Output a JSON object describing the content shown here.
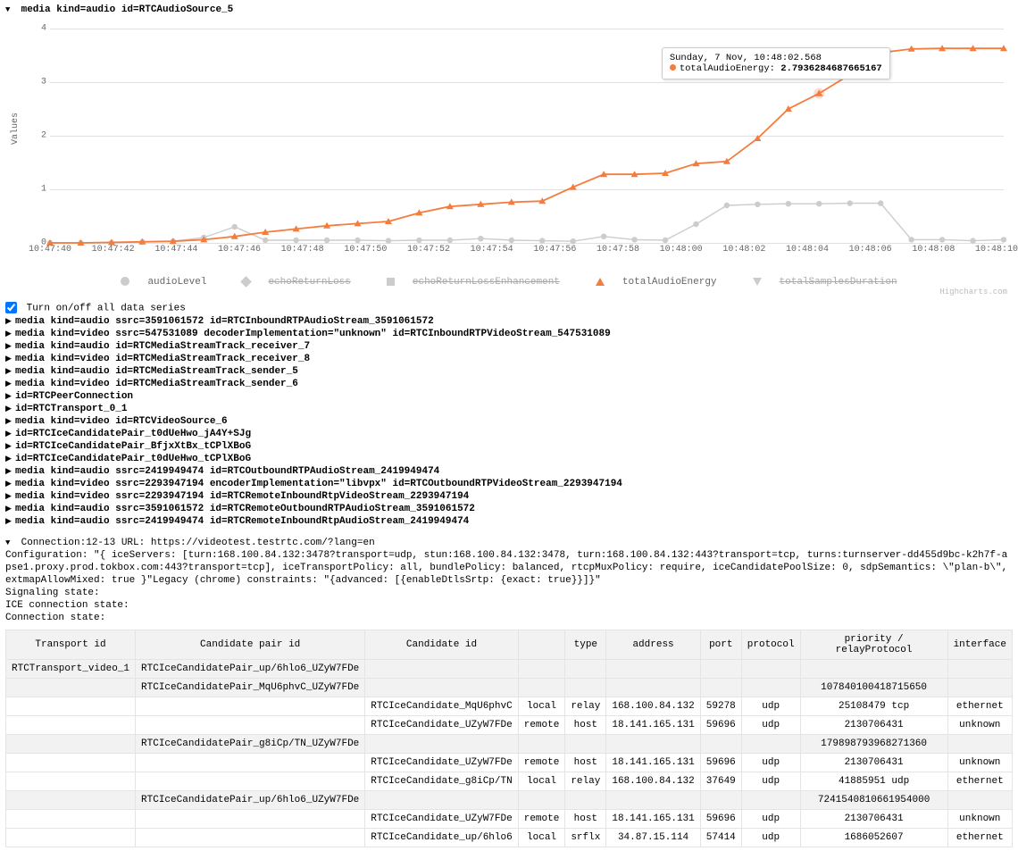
{
  "header": {
    "expanded_item": "media kind=audio id=RTCAudioSource_5"
  },
  "chart_data": {
    "type": "line",
    "ylabel": "Values",
    "xlabel": "",
    "ylim": [
      0,
      4
    ],
    "y_ticks": [
      0,
      1,
      2,
      3,
      4
    ],
    "x_ticks": [
      "10:47:40",
      "10:47:42",
      "10:47:44",
      "10:47:46",
      "10:47:48",
      "10:47:50",
      "10:47:52",
      "10:47:54",
      "10:47:56",
      "10:47:58",
      "10:48:00",
      "10:48:02",
      "10:48:04",
      "10:48:06",
      "10:48:08",
      "10:48:10"
    ],
    "series": [
      {
        "name": "audioLevel",
        "color": "#cccccc",
        "active": true,
        "marker": "circle",
        "values": [
          0,
          0,
          0,
          0.02,
          0.03,
          0.1,
          0.3,
          0.05,
          0.05,
          0.05,
          0.05,
          0.04,
          0.05,
          0.05,
          0.08,
          0.05,
          0.04,
          0.03,
          0.12,
          0.06,
          0.05,
          0.35,
          0.7,
          0.72,
          0.73,
          0.73,
          0.74,
          0.74,
          0.06,
          0.06,
          0.04,
          0.06
        ]
      },
      {
        "name": "echoReturnLoss",
        "color": "#cccccc",
        "active": false,
        "marker": "diamond",
        "values": []
      },
      {
        "name": "echoReturnLossEnhancement",
        "color": "#cccccc",
        "active": false,
        "marker": "square",
        "values": []
      },
      {
        "name": "totalAudioEnergy",
        "color": "#f47c3c",
        "active": true,
        "marker": "triangle",
        "values": [
          0,
          0,
          0.01,
          0.02,
          0.03,
          0.06,
          0.12,
          0.2,
          0.26,
          0.32,
          0.36,
          0.4,
          0.56,
          0.68,
          0.72,
          0.76,
          0.78,
          1.04,
          1.28,
          1.28,
          1.3,
          1.48,
          1.52,
          1.95,
          2.5,
          2.79,
          3.14,
          3.55,
          3.62,
          3.63,
          3.63,
          3.63
        ]
      },
      {
        "name": "totalSamplesDuration",
        "color": "#cccccc",
        "active": false,
        "marker": "triangle-down",
        "values": []
      }
    ],
    "tooltip": {
      "time_label": "Sunday, 7 Nov, 10:48:02.568",
      "series_name": "totalAudioEnergy",
      "value_str": "2.7936284687665167",
      "index": 25
    },
    "credits": "Highcharts.com"
  },
  "toggle_all_label": "Turn on/off all data series",
  "collapsed_items": [
    "media kind=audio ssrc=3591061572 id=RTCInboundRTPAudioStream_3591061572",
    "media kind=video ssrc=547531089 decoderImplementation=\"unknown\" id=RTCInboundRTPVideoStream_547531089",
    "media kind=audio id=RTCMediaStreamTrack_receiver_7",
    "media kind=video id=RTCMediaStreamTrack_receiver_8",
    "media kind=audio id=RTCMediaStreamTrack_sender_5",
    "media kind=video id=RTCMediaStreamTrack_sender_6",
    "id=RTCPeerConnection",
    "id=RTCTransport_0_1",
    "media kind=video id=RTCVideoSource_6",
    "id=RTCIceCandidatePair_t0dUeHwo_jA4Y+SJg",
    "id=RTCIceCandidatePair_BfjxXtBx_tCPlXBoG",
    "id=RTCIceCandidatePair_t0dUeHwo_tCPlXBoG",
    "media kind=audio ssrc=2419949474 id=RTCOutboundRTPAudioStream_2419949474",
    "media kind=video ssrc=2293947194 encoderImplementation=\"libvpx\" id=RTCOutboundRTPVideoStream_2293947194",
    "media kind=video ssrc=2293947194 id=RTCRemoteInboundRtpVideoStream_2293947194",
    "media kind=audio ssrc=3591061572 id=RTCRemoteOutboundRTPAudioStream_3591061572",
    "media kind=audio ssrc=2419949474 id=RTCRemoteInboundRtpAudioStream_2419949474"
  ],
  "connection": {
    "heading": "Connection:12-13 URL: https://videotest.testrtc.com/?lang=en",
    "config_line": "Configuration: \"{ iceServers: [turn:168.100.84.132:3478?transport=udp, stun:168.100.84.132:3478, turn:168.100.84.132:443?transport=tcp, turns:turnserver-dd455d9bc-k2h7f-apse1.proxy.prod.tokbox.com:443?transport=tcp], iceTransportPolicy: all, bundlePolicy: balanced, rtcpMuxPolicy: require, iceCandidatePoolSize: 0, sdpSemantics: \\\"plan-b\\\", extmapAllowMixed: true }\"Legacy (chrome) constraints: \"{advanced: [{enableDtlsSrtp: {exact: true}}]}\"",
    "signaling_label": "Signaling state:",
    "ice_label": "ICE connection state:",
    "conn_label": "Connection state:"
  },
  "table": {
    "headers": [
      "Transport id",
      "Candidate pair id",
      "Candidate id",
      "",
      "type",
      "address",
      "port",
      "protocol",
      "priority / relayProtocol",
      "interface"
    ],
    "rows": [
      {
        "kind": "pair",
        "cells": [
          "RTCTransport_video_1",
          "RTCIceCandidatePair_up/6hlo6_UZyW7FDe",
          "",
          "",
          "",
          "",
          "",
          "",
          "",
          ""
        ]
      },
      {
        "kind": "pair",
        "cells": [
          "",
          "RTCIceCandidatePair_MqU6phvC_UZyW7FDe",
          "",
          "",
          "",
          "",
          "",
          "",
          "107840100418715650",
          ""
        ]
      },
      {
        "kind": "cand",
        "cells": [
          "",
          "",
          "RTCIceCandidate_MqU6phvC",
          "local",
          "relay",
          "168.100.84.132",
          "59278",
          "udp",
          "25108479 tcp",
          "ethernet"
        ]
      },
      {
        "kind": "cand",
        "cells": [
          "",
          "",
          "RTCIceCandidate_UZyW7FDe",
          "remote",
          "host",
          "18.141.165.131",
          "59696",
          "udp",
          "2130706431",
          "unknown"
        ]
      },
      {
        "kind": "pair",
        "cells": [
          "",
          "RTCIceCandidatePair_g8iCp/TN_UZyW7FDe",
          "",
          "",
          "",
          "",
          "",
          "",
          "179898793968271360",
          ""
        ]
      },
      {
        "kind": "cand",
        "cells": [
          "",
          "",
          "RTCIceCandidate_UZyW7FDe",
          "remote",
          "host",
          "18.141.165.131",
          "59696",
          "udp",
          "2130706431",
          "unknown"
        ]
      },
      {
        "kind": "cand",
        "cells": [
          "",
          "",
          "RTCIceCandidate_g8iCp/TN",
          "local",
          "relay",
          "168.100.84.132",
          "37649",
          "udp",
          "41885951 udp",
          "ethernet"
        ]
      },
      {
        "kind": "pair",
        "cells": [
          "",
          "RTCIceCandidatePair_up/6hlo6_UZyW7FDe",
          "",
          "",
          "",
          "",
          "",
          "",
          "7241540810661954000",
          ""
        ]
      },
      {
        "kind": "cand",
        "cells": [
          "",
          "",
          "RTCIceCandidate_UZyW7FDe",
          "remote",
          "host",
          "18.141.165.131",
          "59696",
          "udp",
          "2130706431",
          "unknown"
        ]
      },
      {
        "kind": "cand",
        "cells": [
          "",
          "",
          "RTCIceCandidate_up/6hlo6",
          "local",
          "srflx",
          "34.87.15.114",
          "57414",
          "udp",
          "1686052607",
          "ethernet"
        ]
      }
    ]
  }
}
